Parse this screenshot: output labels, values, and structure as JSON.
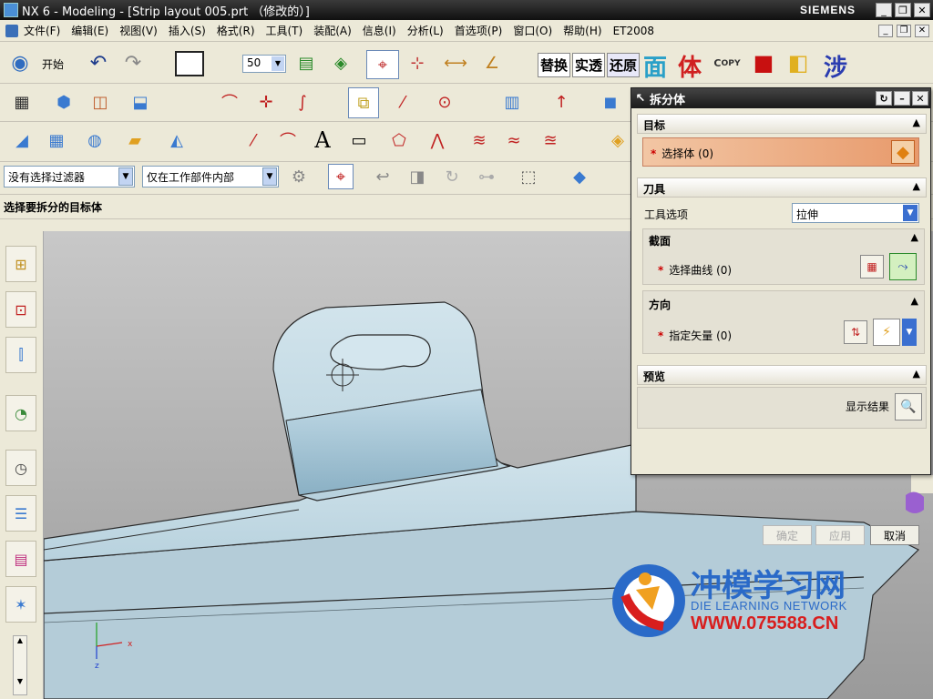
{
  "window": {
    "title": "NX 6 - Modeling - [Strip layout 005.prt （修改的）]",
    "brand": "SIEMENS"
  },
  "menu": {
    "items": [
      "文件(F)",
      "编辑(E)",
      "视图(V)",
      "插入(S)",
      "格式(R)",
      "工具(T)",
      "装配(A)",
      "信息(I)",
      "分析(L)",
      "首选项(P)",
      "窗口(O)",
      "帮助(H)",
      "ET2008"
    ]
  },
  "toolbar": {
    "start_label": "开始",
    "layer_value": "50",
    "text_tools": [
      "替换",
      "实透",
      "还原",
      "面",
      "体",
      "涉"
    ]
  },
  "filter_bar": {
    "type_filter": "没有选择过滤器",
    "scope_filter": "仅在工作部件内部"
  },
  "cue_line": "选择要拆分的目标体",
  "dialog": {
    "title": "拆分体",
    "target": {
      "header": "目标",
      "select_body": "选择体 (0)"
    },
    "tool": {
      "header": "刀具",
      "tool_option_label": "工具选项",
      "tool_option_value": "拉伸",
      "section": {
        "header": "截面",
        "select_curve": "选择曲线 (0)"
      },
      "direction": {
        "header": "方向",
        "specify_vector": "指定矢量 (0)"
      }
    },
    "preview": {
      "header": "预览",
      "show_result": "显示结果"
    },
    "buttons": {
      "ok": "确定",
      "apply": "应用",
      "cancel": "取消"
    }
  },
  "watermark": {
    "cn": "冲模学习网",
    "en": "DIE LEARNING NETWORK",
    "url": "WWW.075588.CN"
  },
  "triad": {
    "x": "x",
    "z": "z"
  },
  "colors": {
    "titlebar": "#1a1a1a",
    "selection_highlight": "#f0b48a",
    "part_surface": "#c6dde8",
    "watermark_red": "#d81e1e",
    "watermark_blue": "#2a6ac8"
  }
}
